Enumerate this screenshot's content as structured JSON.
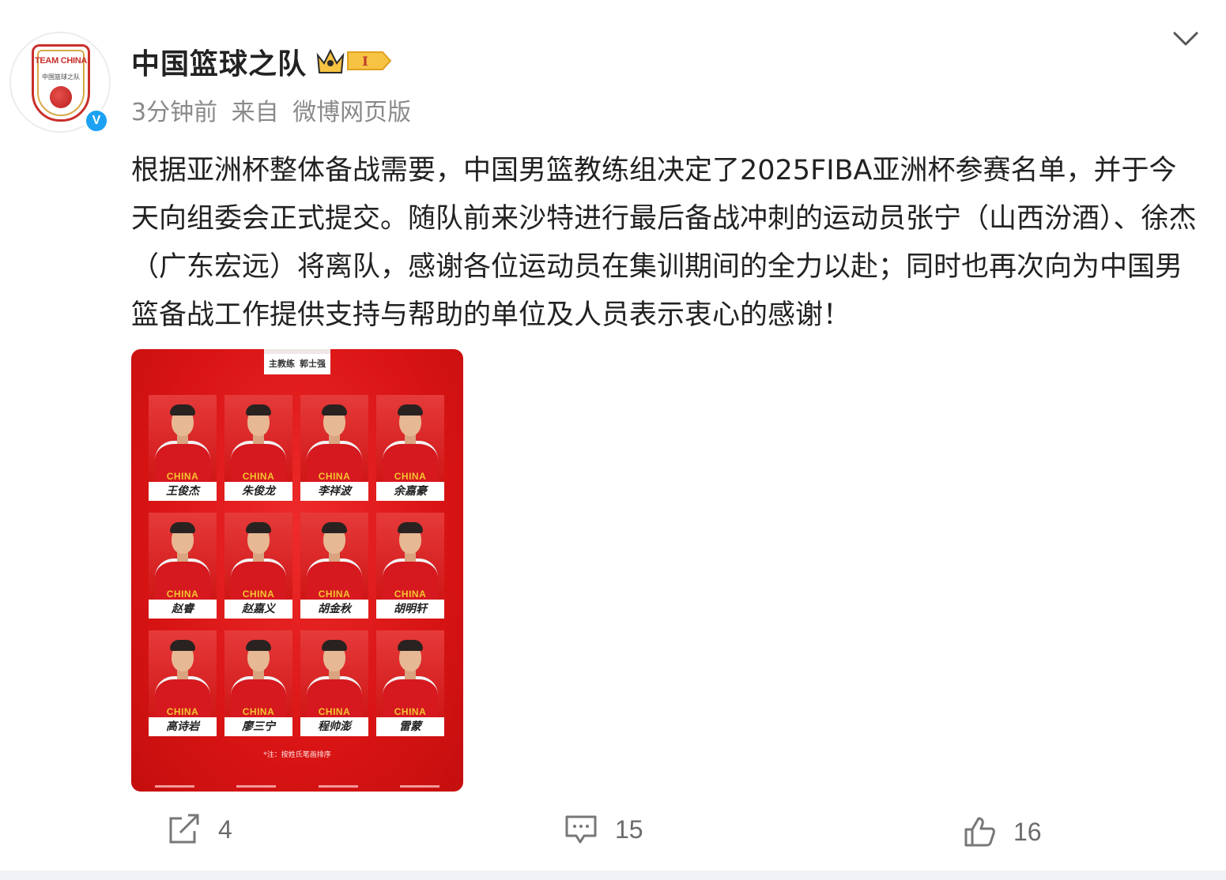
{
  "author": {
    "name": "中国篮球之队",
    "avatar_text": "TEAM CHINA",
    "avatar_subtext": "中国篮球之队",
    "verified_icon": "V",
    "vip_level": "I"
  },
  "meta": {
    "time": "3分钟前",
    "source_prefix": "来自",
    "source": "微博网页版"
  },
  "post": {
    "text": "根据亚洲杯整体备战需要，中国男篮教练组决定了2025FIBA亚洲杯参赛名单，并于今天向组委会正式提交。随队前来沙特进行最后备战冲刺的运动员张宁（山西汾酒）、徐杰（广东宏远）将离队，感谢各位运动员在集训期间的全力以赴；同时也再次向为中国男篮备战工作提供支持与帮助的单位及人员表示衷心的感谢！"
  },
  "poster": {
    "coach_label": "主教练",
    "coach_name": "郭士强",
    "jersey_text": "CHINA",
    "players": [
      "王俊杰",
      "朱俊龙",
      "李祥波",
      "余嘉豪",
      "赵睿",
      "赵嘉义",
      "胡金秋",
      "胡明轩",
      "高诗岩",
      "廖三宁",
      "程帅澎",
      "雷蒙"
    ],
    "note": "*注：按姓氏笔画排序"
  },
  "actions": {
    "share_count": "4",
    "comment_count": "15",
    "like_count": "16"
  },
  "colors": {
    "poster_red": "#d91414",
    "verified_blue": "#1da1f2",
    "vip_gold": "#f6c343"
  },
  "icons": {
    "share": "share-icon",
    "comment": "comment-icon",
    "like": "like-icon",
    "menu": "chevron-down-icon"
  }
}
